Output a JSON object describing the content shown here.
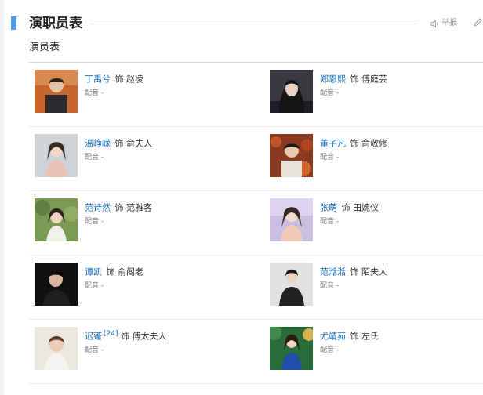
{
  "header": {
    "title": "演职员表",
    "report_label": "举报"
  },
  "cast": {
    "subtitle": "演员表",
    "dub_label": "配音",
    "dub_value": "-",
    "role_prefix": "饰",
    "entries": [
      {
        "actor": "丁禹兮",
        "role": "赵凌",
        "ref": ""
      },
      {
        "actor": "郑恩熙",
        "role": "傅庭芸",
        "ref": ""
      },
      {
        "actor": "温峥嵘",
        "role": "俞夫人",
        "ref": ""
      },
      {
        "actor": "董子凡",
        "role": "俞敬修",
        "ref": ""
      },
      {
        "actor": "范诗然",
        "role": "范雅客",
        "ref": ""
      },
      {
        "actor": "张萌",
        "role": "田婉仪",
        "ref": ""
      },
      {
        "actor": "谭凯",
        "role": "俞阁老",
        "ref": ""
      },
      {
        "actor": "范湉湉",
        "role": "陌夫人",
        "ref": ""
      },
      {
        "actor": "迟蓬",
        "role": "傅太夫人",
        "ref": "[24]"
      },
      {
        "actor": "尤靖茹",
        "role": "左氏",
        "ref": ""
      }
    ]
  },
  "colors": {
    "accent": "#4f9cee",
    "link": "#136ec2"
  },
  "icons": {
    "report": "speaker-icon",
    "edit": "pencil-icon",
    "photos": [
      "actor-photo-brown-suit",
      "actor-photo-dark-hair",
      "actor-photo-pink-dress",
      "actor-photo-autumn-leaves",
      "actor-photo-green-garden",
      "actor-photo-pastel",
      "actor-photo-black-suit",
      "actor-photo-black-outfit",
      "actor-photo-light-background",
      "actor-photo-blue-dress"
    ]
  }
}
